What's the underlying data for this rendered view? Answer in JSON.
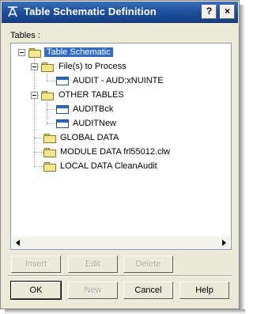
{
  "window": {
    "title": "Table Schematic Definition",
    "help_button": "?",
    "close_button": "×"
  },
  "tables_label": "Tables :",
  "tree": [
    {
      "label": "Table Schematic",
      "icon": "folder-icon",
      "selected": true
    },
    {
      "label": "File(s) to Process",
      "icon": "folder-icon"
    },
    {
      "label": "AUDIT - AUD:xNUINTE",
      "icon": "table-icon"
    },
    {
      "label": "OTHER TABLES",
      "icon": "folder-icon"
    },
    {
      "label": "AUDITBck",
      "icon": "table-icon"
    },
    {
      "label": "AUDITNew",
      "icon": "table-icon"
    },
    {
      "label": "GLOBAL DATA",
      "icon": "folder-icon"
    },
    {
      "label": "MODULE DATA frl55012.clw",
      "icon": "folder-icon"
    },
    {
      "label": "LOCAL DATA CleanAudit",
      "icon": "folder-icon"
    }
  ],
  "edit_buttons": {
    "insert": "Insert",
    "edit": "Edit",
    "delete": "Delete"
  },
  "dialog_buttons": {
    "ok": "OK",
    "new": "New",
    "cancel": "Cancel",
    "help": "Help"
  },
  "colors": {
    "titlebar": "#1d4f9c",
    "selection": "#316ac5",
    "dialog_bg": "#ece9d8"
  }
}
